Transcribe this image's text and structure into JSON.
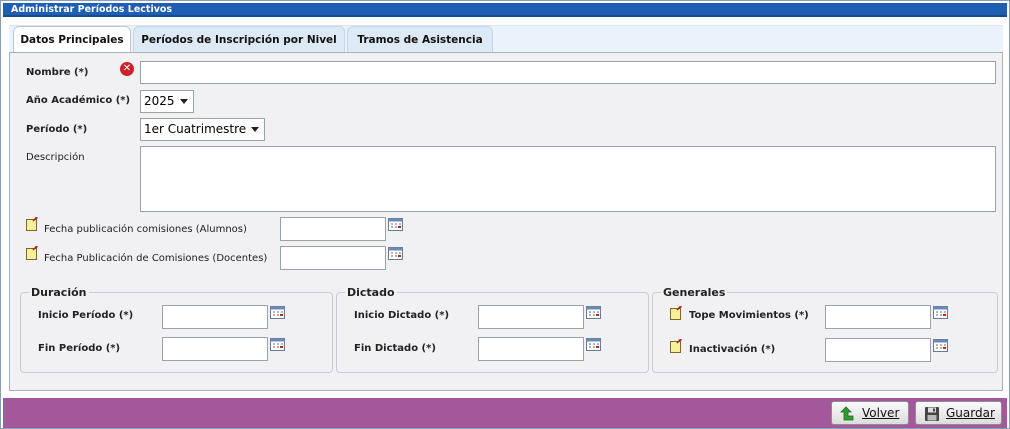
{
  "window": {
    "title": "Administrar Períodos Lectivos"
  },
  "tabs": [
    {
      "label": "Datos Principales",
      "active": true
    },
    {
      "label": "Períodos de Inscripción por Nivel",
      "active": false
    },
    {
      "label": "Tramos de Asistencia",
      "active": false
    }
  ],
  "form": {
    "nombre": {
      "label": "Nombre (*)",
      "value": "",
      "error": true
    },
    "anio": {
      "label": "Año Académico (*)",
      "value": "2025"
    },
    "periodo": {
      "label": "Período (*)",
      "value": "1er Cuatrimestre"
    },
    "descripcion": {
      "label": "Descripción",
      "value": ""
    },
    "fecha_alumnos": {
      "label": "Fecha publicación comisiones (Alumnos)",
      "value": ""
    },
    "fecha_docentes": {
      "label": "Fecha Publicación de Comisiones (Docentes)",
      "value": ""
    }
  },
  "duracion": {
    "legend": "Duración",
    "inicio": {
      "label": "Inicio Período (*)",
      "value": ""
    },
    "fin": {
      "label": "Fin Período (*)",
      "value": ""
    }
  },
  "dictado": {
    "legend": "Dictado",
    "inicio": {
      "label": "Inicio Dictado (*)",
      "value": ""
    },
    "fin": {
      "label": "Fin Dictado (*)",
      "value": ""
    }
  },
  "generales": {
    "legend": "Generales",
    "tope": {
      "label": "Tope Movimientos (*)",
      "value": ""
    },
    "inactivacion": {
      "label": "Inactivación (*)",
      "value": ""
    }
  },
  "buttons": {
    "volver": {
      "label": "Volver",
      "icon": "back-arrow-icon"
    },
    "guardar": {
      "label": "Guardar",
      "icon": "floppy-disk-icon"
    }
  },
  "colors": {
    "titlebar": "#1e5fb4",
    "footer": "#a3589b",
    "error": "#cc2229"
  }
}
